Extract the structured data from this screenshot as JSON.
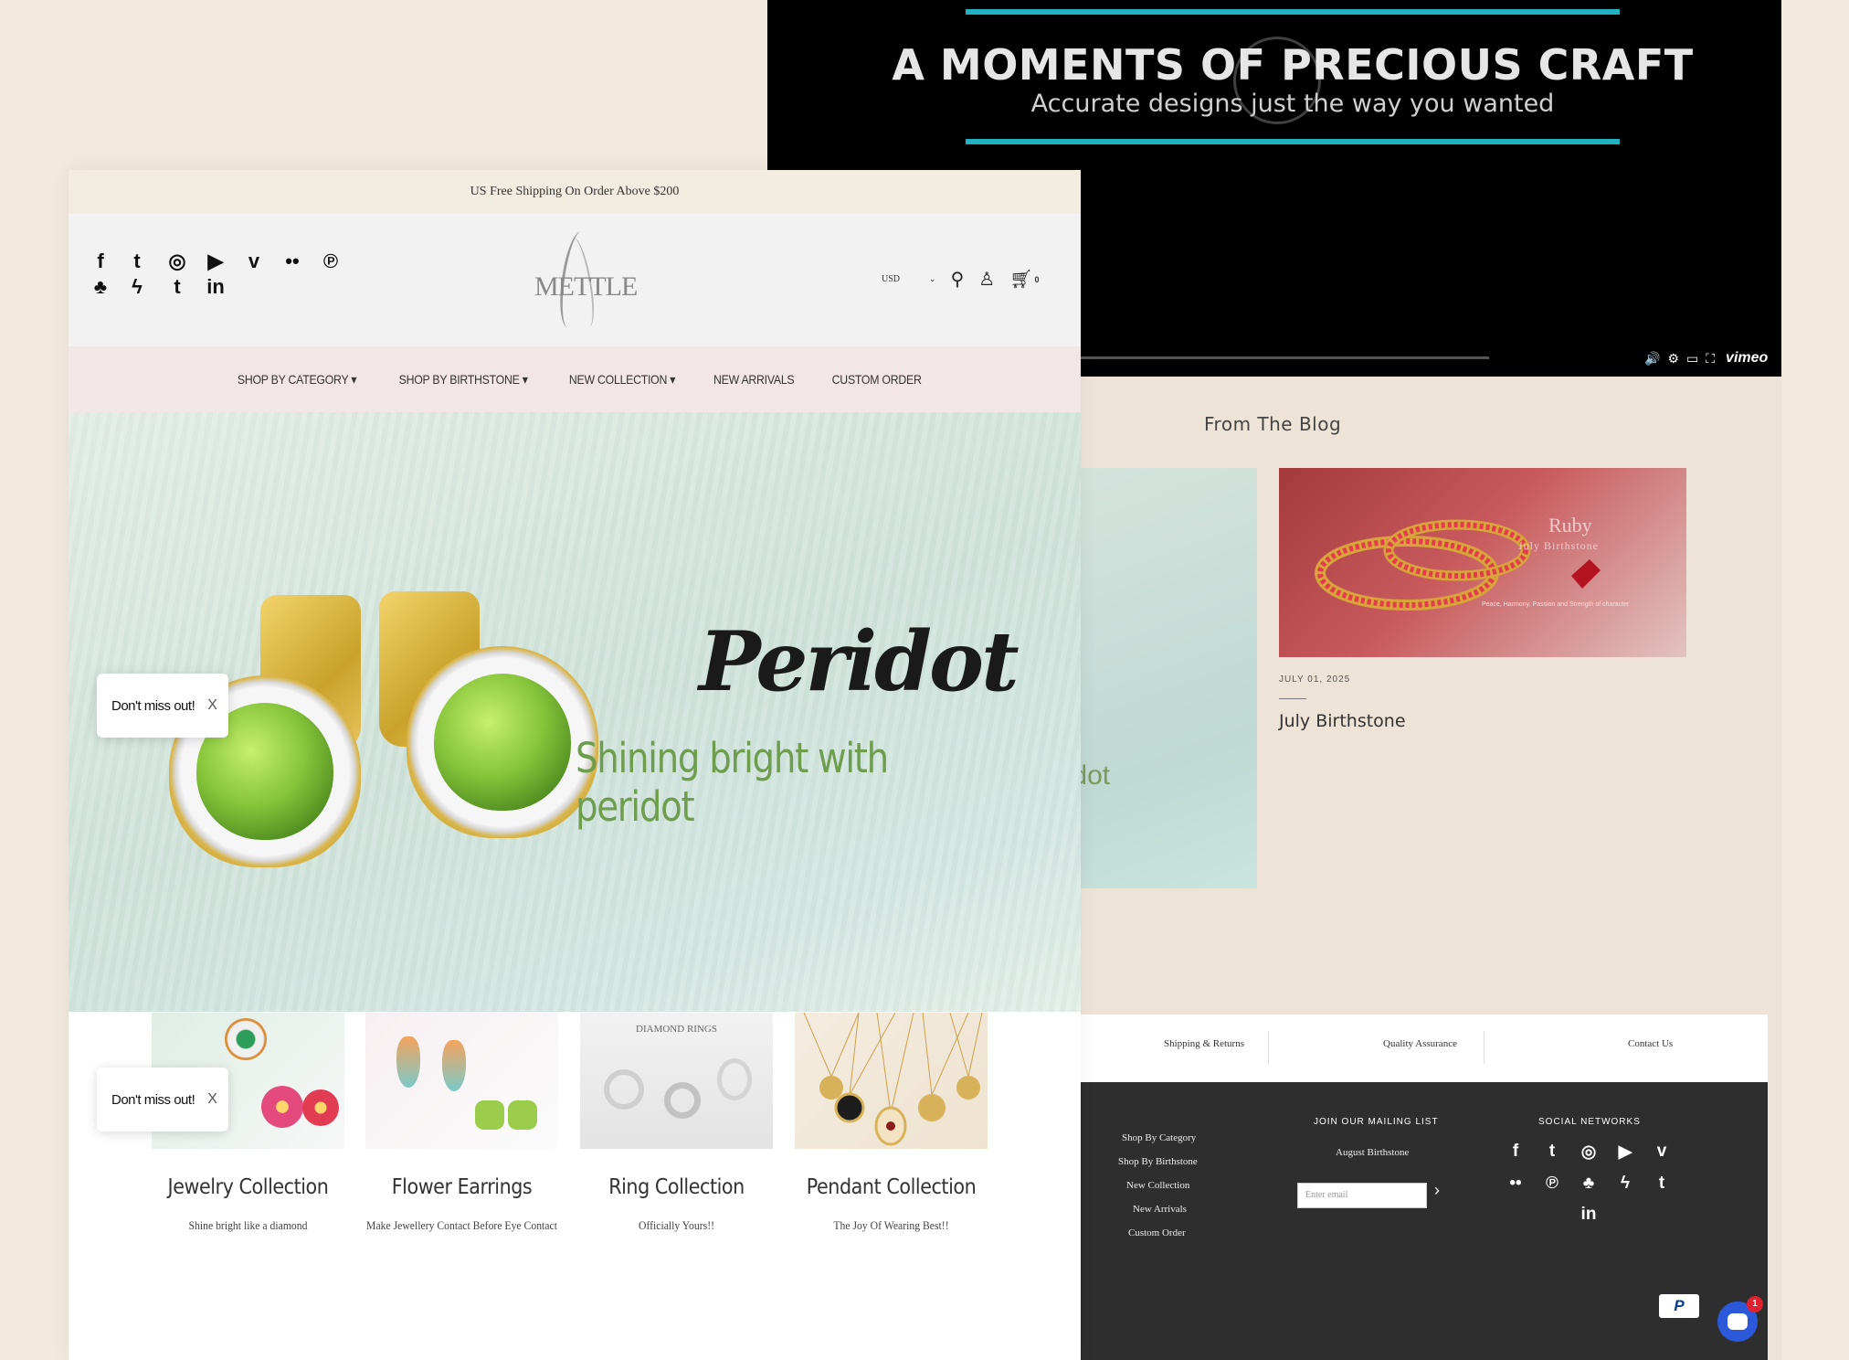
{
  "video": {
    "title": "A MOMENTS OF PRECIOUS CRAFT",
    "subtitle": "Accurate designs just the way you wanted",
    "brand": "vimeo",
    "accent": "#20b2c2"
  },
  "blog": {
    "heading": "From The Blog",
    "image_fragment_text": "th peridot",
    "ruby_title": "Ruby",
    "ruby_subtitle": "July Birthstone",
    "ruby_desc": "Peace, Harmony, Passion and Strength of character",
    "post_date": "JULY 01, 2025",
    "post_title": "July Birthstone"
  },
  "footer_links": [
    "Shipping & Returns",
    "Quality Assurance",
    "Contact Us"
  ],
  "footer": {
    "menu": [
      "Shop By Category",
      "Shop By Birthstone",
      "New Collection",
      "New Arrivals",
      "Custom Order"
    ],
    "mailing_heading": "JOIN OUR MAILING LIST",
    "mailing_link": "August Birthstone",
    "email_placeholder": "Enter email",
    "social_heading": "SOCIAL NETWORKS",
    "paypal": "P",
    "chat_badge": "1"
  },
  "front": {
    "announcement": "US Free Shipping On Order Above $200",
    "logo": "METTLE",
    "currency": "USD",
    "cart_count": "0",
    "nav": [
      "SHOP BY CATEGORY ▾",
      "SHOP BY BIRTHSTONE ▾",
      "NEW COLLECTION ▾",
      "NEW ARRIVALS",
      "CUSTOM ORDER"
    ],
    "hero_title": "Peridot",
    "hero_subtitle": "Shining bright with peridot",
    "toast": "Don't miss out!",
    "toast_close": "X",
    "cards": [
      {
        "name": "Jewelry Collection",
        "desc": "Shine bright like a diamond"
      },
      {
        "name": "Flower Earrings",
        "desc": "Make Jewellery Contact Before Eye Contact"
      },
      {
        "name": "Ring Collection",
        "desc": "Officially Yours!!",
        "img_label": "DIAMOND RINGS"
      },
      {
        "name": "Pendant Collection",
        "desc": "The Joy Of Wearing Best!!"
      }
    ]
  }
}
